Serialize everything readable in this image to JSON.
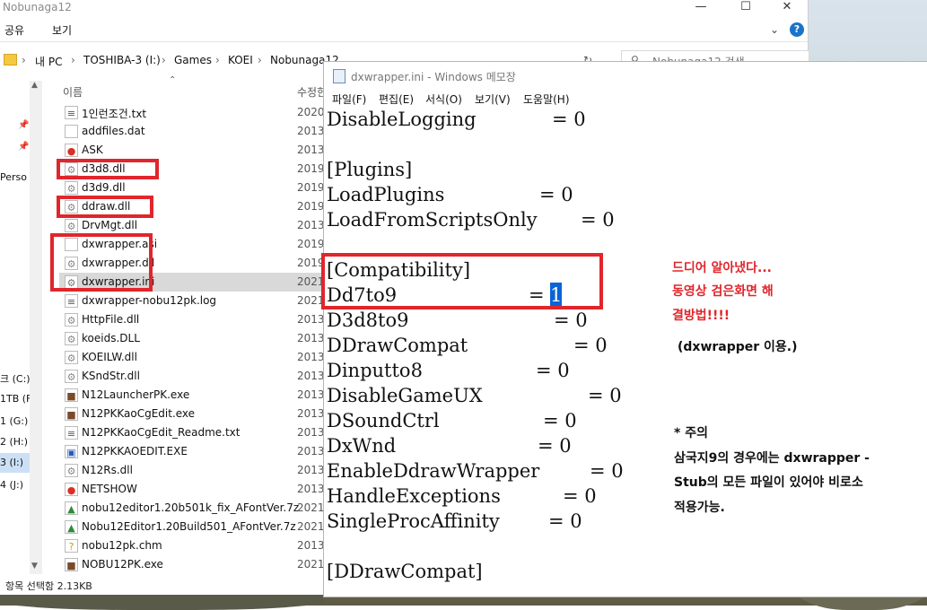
{
  "explorer": {
    "window_title": "Nobunaga12",
    "ribbon_tabs": [
      "공유",
      "보기"
    ],
    "window_buttons": [
      "—",
      "☐",
      "✕"
    ],
    "help_icon": "?",
    "breadcrumb": [
      "내 PC",
      "TOSHIBA-3 (I:)",
      "Games",
      "KOEI",
      "Nobunaga12"
    ],
    "search_placeholder": "Nobunaga12 검색",
    "col_name": "이름",
    "col_modified": "수정한",
    "nav_items": [
      "Perso",
      "크 (C:)",
      "1TB (F",
      "1 (G:)",
      "2 (H:)",
      "3 (I:)",
      "4 (J:)"
    ],
    "files": [
      {
        "name": "1인런조건.txt",
        "date": "2020-",
        "icon": "text-file-icon"
      },
      {
        "name": "addfiles.dat",
        "date": "2013-",
        "icon": "blank-file-icon"
      },
      {
        "name": "ASK",
        "date": "2013-",
        "icon": "chrome-icon"
      },
      {
        "name": "d3d8.dll",
        "date": "2019-",
        "icon": "dll-file-icon"
      },
      {
        "name": "d3d9.dll",
        "date": "2019-",
        "icon": "dll-file-icon"
      },
      {
        "name": "ddraw.dll",
        "date": "2019-",
        "icon": "dll-file-icon"
      },
      {
        "name": "DrvMgt.dll",
        "date": "2013-",
        "icon": "dll-file-icon"
      },
      {
        "name": "dxwrapper.asi",
        "date": "2019-",
        "icon": "blank-file-icon"
      },
      {
        "name": "dxwrapper.dll",
        "date": "2019-",
        "icon": "dll-file-icon"
      },
      {
        "name": "dxwrapper.ini",
        "date": "2021-",
        "icon": "settings-file-icon"
      },
      {
        "name": "dxwrapper-nobu12pk.log",
        "date": "2021-",
        "icon": "text-file-icon"
      },
      {
        "name": "HttpFile.dll",
        "date": "2013-",
        "icon": "dll-file-icon"
      },
      {
        "name": "koeids.DLL",
        "date": "2013-",
        "icon": "dll-file-icon"
      },
      {
        "name": "KOEILW.dll",
        "date": "2013-",
        "icon": "dll-file-icon"
      },
      {
        "name": "KSndStr.dll",
        "date": "2013-",
        "icon": "dll-file-icon"
      },
      {
        "name": "N12LauncherPK.exe",
        "date": "2013-",
        "icon": "game-exe-icon"
      },
      {
        "name": "N12PKKaoCgEdit.exe",
        "date": "2013-",
        "icon": "game-exe-icon"
      },
      {
        "name": "N12PKKaoCgEdit_Readme.txt",
        "date": "2013-",
        "icon": "text-file-icon"
      },
      {
        "name": "N12PKKAOEDIT.EXE",
        "date": "2013-",
        "icon": "app-exe-icon"
      },
      {
        "name": "N12Rs.dll",
        "date": "2013-",
        "icon": "dll-file-icon"
      },
      {
        "name": "NETSHOW",
        "date": "2013-",
        "icon": "chrome-icon"
      },
      {
        "name": "nobu12editor1.20b501k_fix_AFontVer.7z",
        "date": "2021-",
        "icon": "archive-icon"
      },
      {
        "name": "Nobu12Editor1.20Build501_AFontVer.7z",
        "date": "2021-",
        "icon": "archive-icon"
      },
      {
        "name": "nobu12pk.chm",
        "date": "2013-",
        "icon": "help-file-icon"
      },
      {
        "name": "NOBU12PK.exe",
        "date": "2021-",
        "icon": "game-exe-icon"
      }
    ],
    "status_text": "항목 선택함 2.13KB"
  },
  "notepad": {
    "title": "dxwrapper.ini - Windows 메모장",
    "menu": [
      "파일(F)",
      "편집(E)",
      "서식(O)",
      "보기(V)",
      "도움말(H)"
    ],
    "lines": [
      {
        "key": "DisableLogging",
        "val": "= 0"
      },
      {
        "key": "",
        "val": ""
      },
      {
        "key": "[Plugins]",
        "val": ""
      },
      {
        "key": "LoadPlugins",
        "val": "= 0"
      },
      {
        "key": "LoadFromScriptsOnly",
        "val": "= 0"
      },
      {
        "key": "",
        "val": ""
      },
      {
        "key": "[Compatibility]",
        "val": ""
      },
      {
        "key": "Dd7to9",
        "val": "= ",
        "hl": "1"
      },
      {
        "key": "D3d8to9",
        "val": "= 0"
      },
      {
        "key": "DDrawCompat",
        "val": "= 0"
      },
      {
        "key": "Dinputto8",
        "val": "= 0"
      },
      {
        "key": "DisableGameUX",
        "val": "= 0"
      },
      {
        "key": "DSoundCtrl",
        "val": "= 0"
      },
      {
        "key": "DxWnd",
        "val": "= 0"
      },
      {
        "key": "EnableDdrawWrapper",
        "val": "= 0"
      },
      {
        "key": "HandleExceptions",
        "val": "= 0"
      },
      {
        "key": "SingleProcAffinity",
        "val": "= 0"
      },
      {
        "key": "",
        "val": ""
      },
      {
        "key": "[DDrawCompat]",
        "val": ""
      }
    ]
  },
  "annotations": {
    "red_lines": [
      "드디어 알아냈다...",
      "동영상 검은화면 해",
      "결방법!!!!"
    ],
    "note_paren": "(dxwrapper 이용.)",
    "caution_lines": [
      "* 주의",
      "삼국지9의 경우에는 dxwrapper -",
      "Stub의 모든 파일이 있어야 비로소",
      "적용가능."
    ]
  },
  "colors": {
    "highlight_red": "#e0262c",
    "selection_blue": "#0a64d6"
  }
}
